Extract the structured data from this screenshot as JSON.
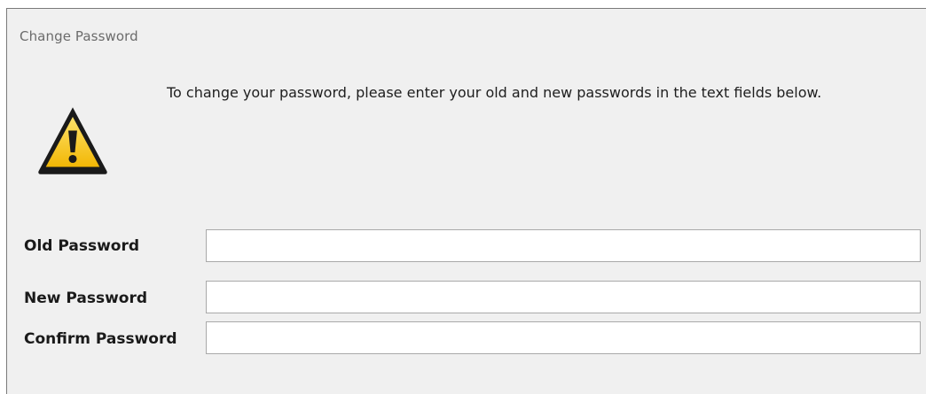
{
  "dialog": {
    "title": "Change Password",
    "message": "To change your password, please enter your old and new passwords in the text fields below.",
    "icon": "warning-icon"
  },
  "fields": {
    "old_password": {
      "label": "Old Password",
      "value": "",
      "placeholder": ""
    },
    "new_password": {
      "label": "New Password",
      "value": "",
      "placeholder": ""
    },
    "confirm_password": {
      "label": "Confirm Password",
      "value": "",
      "placeholder": ""
    }
  },
  "colors": {
    "dialog_background": "#f0f0f0",
    "warning_fill": "#f5c518",
    "warning_outline": "#1a1a1a"
  }
}
